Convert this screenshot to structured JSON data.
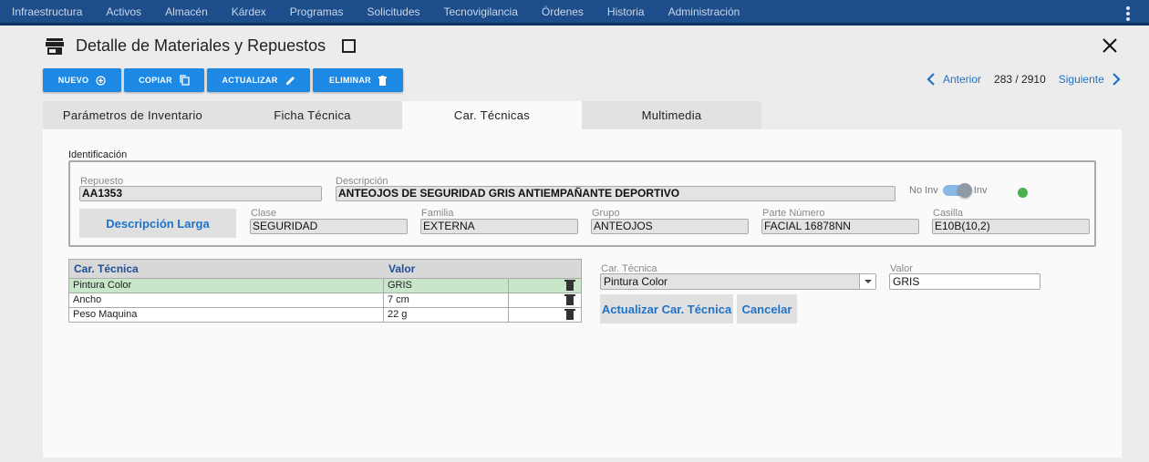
{
  "nav": {
    "items": [
      "Infraestructura",
      "Activos",
      "Almacén",
      "Kárdex",
      "Programas",
      "Solicitudes",
      "Tecnovigilancia",
      "Órdenes",
      "Historia",
      "Administración"
    ]
  },
  "header": {
    "title": "Detalle de Materiales y Repuestos"
  },
  "toolbar": {
    "nuevo": "NUEVO",
    "copiar": "COPIAR",
    "actualizar": "ACTUALIZAR",
    "eliminar": "ELIMINAR"
  },
  "pager": {
    "prev": "Anterior",
    "count": "283 / 2910",
    "next": "Siguiente"
  },
  "tabs": [
    "Parámetros de Inventario",
    "Ficha Técnica",
    "Car. Técnicas",
    "Multimedia"
  ],
  "active_tab": "Car. Técnicas",
  "identificacion": {
    "section_label": "Identificación",
    "repuesto_label": "Repuesto",
    "repuesto": "AA1353",
    "descripcion_label": "Descripción",
    "descripcion": "ANTEOJOS DE SEGURIDAD GRIS ANTIEMPAÑANTE DEPORTIVO",
    "toggle_off": "No Inv",
    "toggle_on": "Inv",
    "desc_larga_button": "Descripción Larga",
    "clase_label": "Clase",
    "clase": "SEGURIDAD",
    "familia_label": "Familia",
    "familia": "EXTERNA",
    "grupo_label": "Grupo",
    "grupo": "ANTEOJOS",
    "parte_label": "Parte Número",
    "parte": "FACIAL 16878NN",
    "casilla_label": "Casilla",
    "casilla": "E10B(10,2)",
    "status_color": "#4caf50"
  },
  "grid": {
    "headers": [
      "Car. Técnica",
      "Valor"
    ],
    "rows": [
      {
        "car": "Pintura Color",
        "valor": "GRIS"
      },
      {
        "car": "Ancho",
        "valor": "7 cm"
      },
      {
        "car": "Peso Maquina",
        "valor": "22 g"
      }
    ]
  },
  "editor": {
    "car_label": "Car. Técnica",
    "car_value": "Pintura Color",
    "valor_label": "Valor",
    "valor_value": "GRIS",
    "update_button": "Actualizar Car. Técnica",
    "cancel_button": "Cancelar"
  },
  "colors": {
    "nav_bg": "#1d4d8a",
    "primary": "#1e88e5",
    "link": "#1e73c8",
    "selected_row": "#c8e6c9"
  }
}
